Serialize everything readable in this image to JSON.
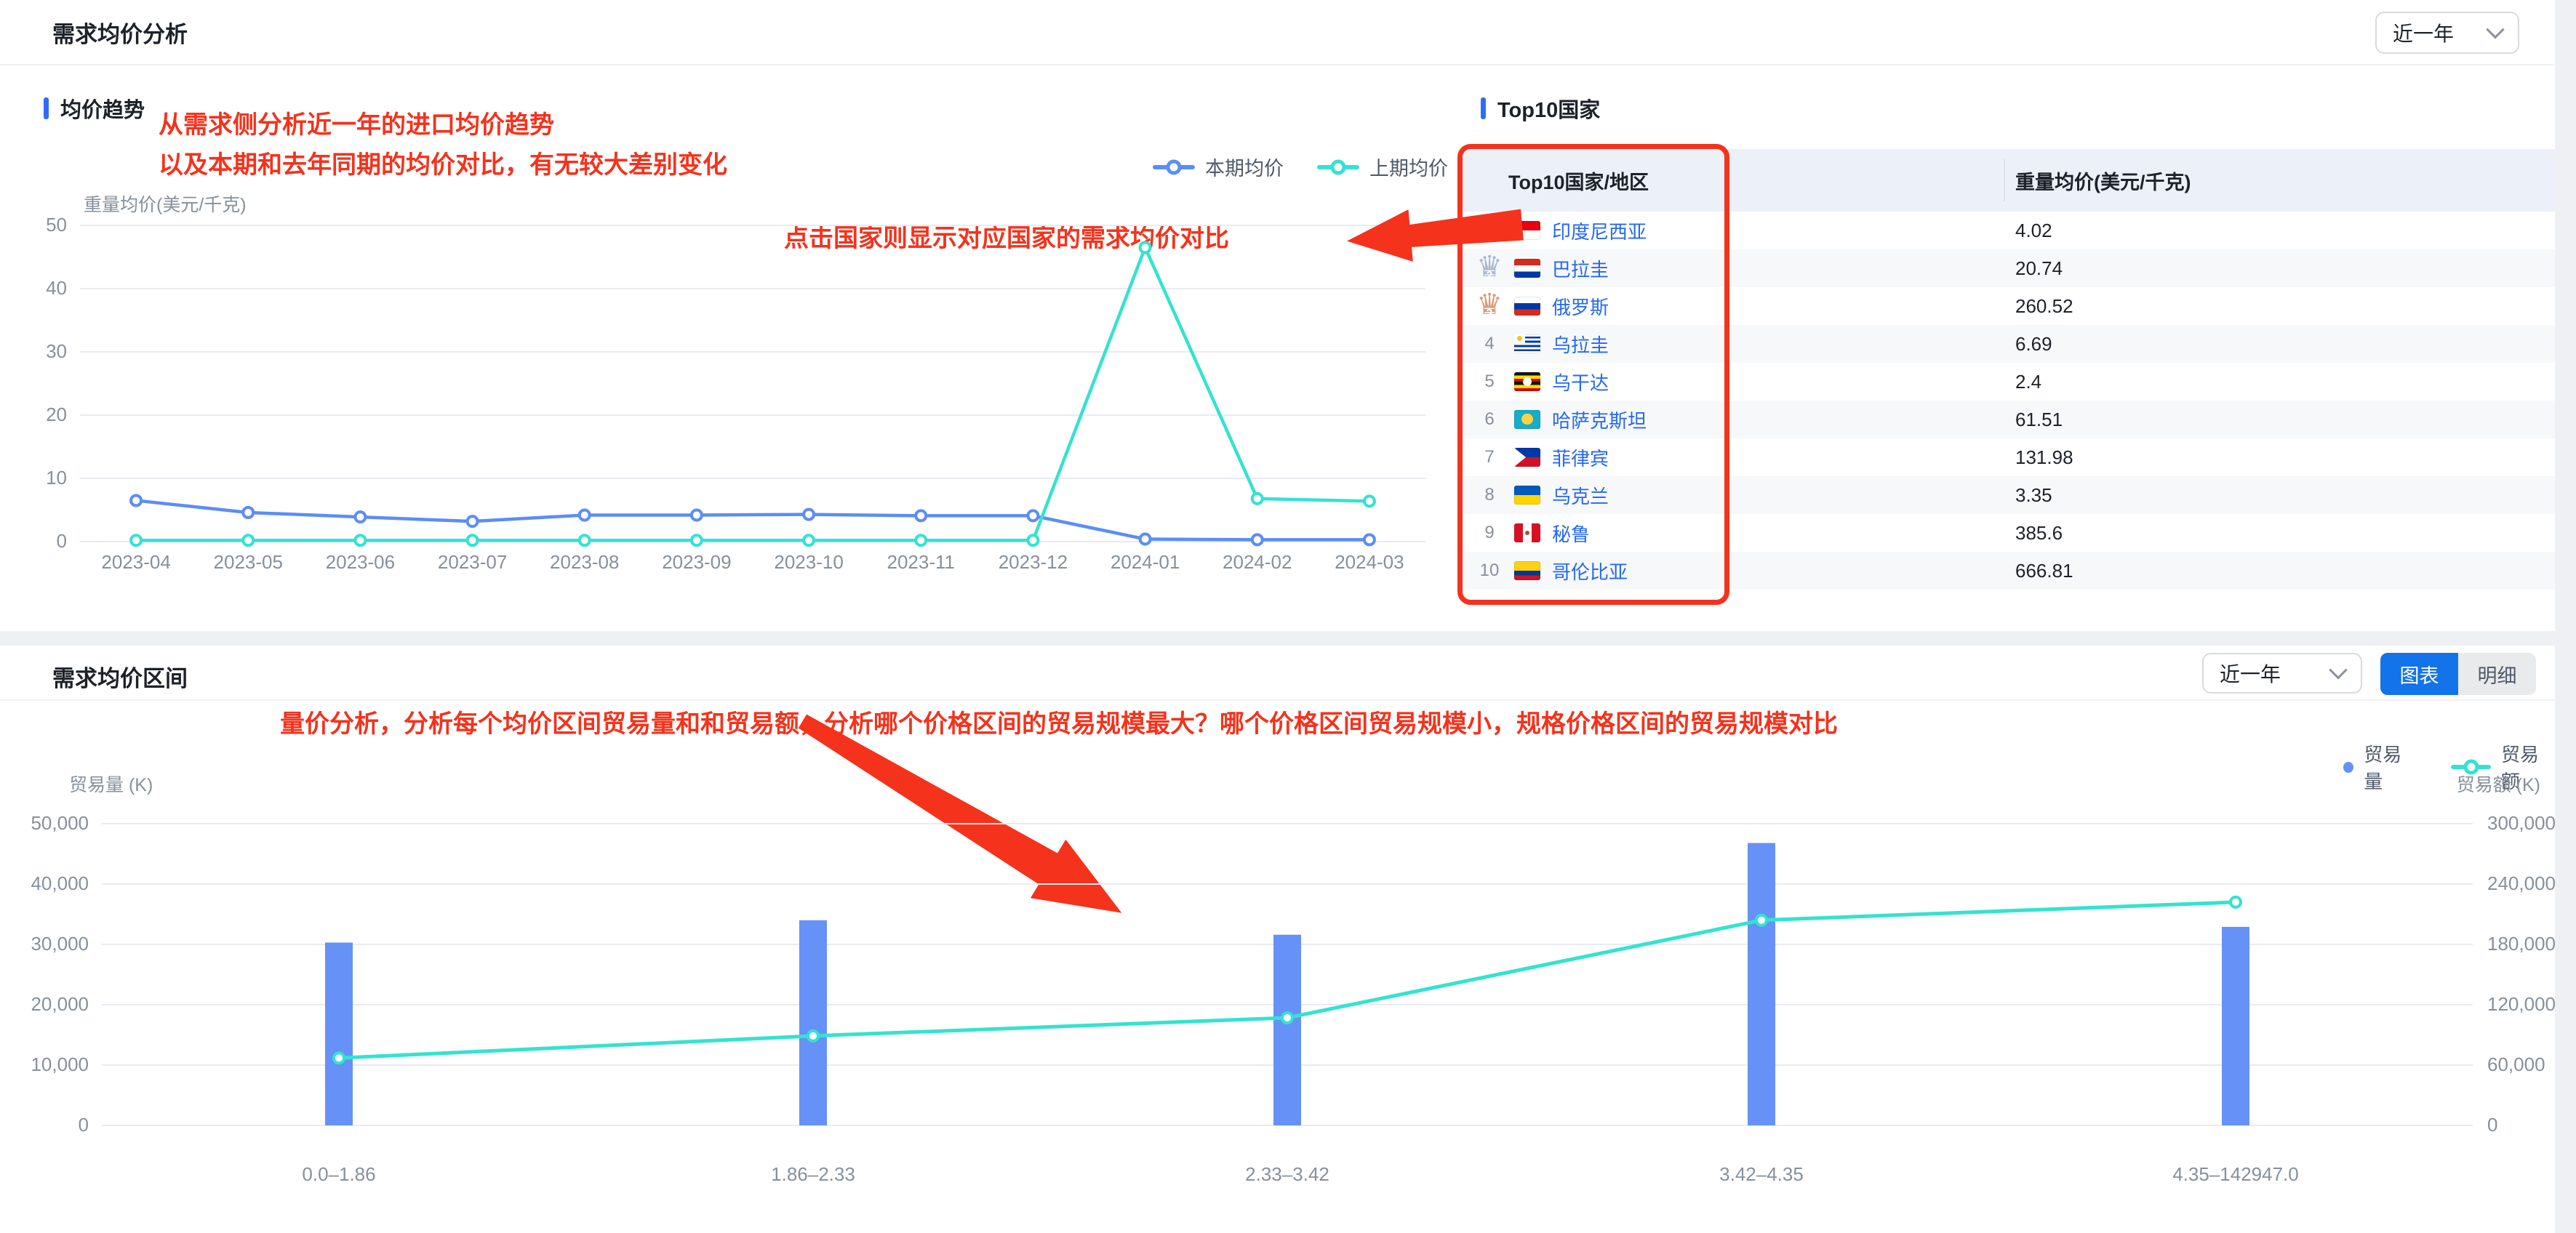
{
  "colors": {
    "accent_blue": "#1273eb",
    "link_blue": "#2468f2",
    "series_blue": "#5c8df6",
    "series_cyan": "#34e3cf",
    "bar_blue": "#6691f7",
    "annotation_red": "#f5321c",
    "axis_gray": "#86909c",
    "table_header_bg": "#ecf0f9"
  },
  "top_card": {
    "title": "需求均价分析",
    "period_select": {
      "value": "近一年"
    },
    "trend": {
      "section_title": "均价趋势",
      "note_line1": "从需求侧分析近一年的进口均价趋势",
      "note_line2": "以及本期和去年同期的均价对比，有无较大差别变化",
      "note_click": "点击国家则显示对应国家的需求均价对比"
    },
    "top10": {
      "section_title": "Top10国家",
      "col_country": "Top10国家/地区",
      "col_value": "重量均价(美元/千克)",
      "rank_medal_colors": [
        "#f2a64a",
        "#aab7cf",
        "#dc9a74"
      ],
      "rows": [
        {
          "rank": 1,
          "country": "印度尼西亚",
          "value": "4.02",
          "flag": {
            "dir": "h",
            "stripes": [
              [
                "#e70011",
                50
              ],
              [
                "#ffffff",
                50
              ]
            ]
          }
        },
        {
          "rank": 2,
          "country": "巴拉圭",
          "value": "20.74",
          "flag": {
            "dir": "h",
            "stripes": [
              [
                "#d52b1e",
                34
              ],
              [
                "#ffffff",
                33
              ],
              [
                "#0038a8",
                33
              ]
            ]
          }
        },
        {
          "rank": 3,
          "country": "俄罗斯",
          "value": "260.52",
          "flag": {
            "dir": "h",
            "stripes": [
              [
                "#ffffff",
                34
              ],
              [
                "#0039a6",
                33
              ],
              [
                "#d52b1e",
                33
              ]
            ]
          }
        },
        {
          "rank": 4,
          "country": "乌拉圭",
          "value": "6.69",
          "flag": {
            "dir": "h",
            "stripes": [
              [
                "#ffffff",
                11
              ],
              [
                "#0038a8",
                11
              ],
              [
                "#ffffff",
                11
              ],
              [
                "#0038a8",
                11
              ],
              [
                "#ffffff",
                12
              ],
              [
                "#0038a8",
                11
              ],
              [
                "#ffffff",
                11
              ],
              [
                "#0038a8",
                11
              ],
              [
                "#ffffff",
                11
              ]
            ],
            "canton": {
              "color": "#ffffff",
              "w": 42,
              "h": 45
            },
            "emblem": {
              "color": "#f5c518",
              "cx": 21,
              "cy": 22,
              "r": 20
            }
          }
        },
        {
          "rank": 5,
          "country": "乌干达",
          "value": "2.4",
          "flag": {
            "dir": "h",
            "stripes": [
              [
                "#141414",
                17
              ],
              [
                "#fcdc04",
                17
              ],
              [
                "#d90000",
                16
              ],
              [
                "#141414",
                17
              ],
              [
                "#fcdc04",
                17
              ],
              [
                "#d90000",
                16
              ]
            ],
            "emblem": {
              "color": "#ffffff",
              "cx": 50,
              "cy": 50,
              "r": 34
            }
          }
        },
        {
          "rank": 6,
          "country": "哈萨克斯坦",
          "value": "61.51",
          "flag": {
            "dir": "h",
            "stripes": [
              [
                "#15adc8",
                100
              ]
            ],
            "emblem": {
              "color": "#ffd23f",
              "cx": 50,
              "cy": 48,
              "r": 42
            }
          }
        },
        {
          "rank": 7,
          "country": "菲律宾",
          "value": "131.98",
          "flag": {
            "dir": "h",
            "stripes": [
              [
                "#0038a8",
                50
              ],
              [
                "#ce1126",
                50
              ]
            ],
            "triangle": "#ffffff"
          }
        },
        {
          "rank": 8,
          "country": "乌克兰",
          "value": "3.35",
          "flag": {
            "dir": "h",
            "stripes": [
              [
                "#005bbb",
                50
              ],
              [
                "#ffd500",
                50
              ]
            ]
          }
        },
        {
          "rank": 9,
          "country": "秘鲁",
          "value": "385.6",
          "flag": {
            "dir": "v",
            "stripes": [
              [
                "#d91023",
                34
              ],
              [
                "#ffffff",
                33
              ],
              [
                "#d91023",
                33
              ]
            ],
            "emblem": {
              "color": "#b5493a",
              "cx": 50,
              "cy": 50,
              "r": 18
            }
          }
        },
        {
          "rank": 10,
          "country": "哥伦比亚",
          "value": "666.81",
          "flag": {
            "dir": "h",
            "stripes": [
              [
                "#fcd116",
                50
              ],
              [
                "#003893",
                25
              ],
              [
                "#ce1126",
                25
              ]
            ]
          }
        }
      ]
    }
  },
  "bottom_card": {
    "title": "需求均价区间",
    "period_select": {
      "value": "近一年"
    },
    "view_toggle": {
      "chart_label": "图表",
      "detail_label": "明细",
      "active": "chart"
    },
    "note": "量价分析，分析每个均价区间贸易量和和贸易额，分析哪个价格区间的贸易规模最大？哪个价格区间贸易规模小，规格价格区间的贸易规模对比"
  },
  "chart_data": [
    {
      "type": "line",
      "title": "均价趋势",
      "y_name": "重量均价(美元/千克)",
      "categories": [
        "2023-04",
        "2023-05",
        "2023-06",
        "2023-07",
        "2023-08",
        "2023-09",
        "2023-10",
        "2023-11",
        "2023-12",
        "2024-01",
        "2024-02",
        "2024-03"
      ],
      "series": [
        {
          "name": "本期均价",
          "color": "#5c8df6",
          "values": [
            6.5,
            4.6,
            3.9,
            3.2,
            4.2,
            4.2,
            4.3,
            4.1,
            4.1,
            0.4,
            0.3,
            0.3
          ]
        },
        {
          "name": "上期均价",
          "color": "#34e3cf",
          "values": [
            0.2,
            0.2,
            0.2,
            0.2,
            0.2,
            0.2,
            0.2,
            0.2,
            0.2,
            46.5,
            6.8,
            6.4
          ]
        }
      ],
      "ylim": [
        0,
        50
      ],
      "y_step": 10,
      "grid": true,
      "legend_position": "top-right"
    },
    {
      "type": "bar+line",
      "title": "需求均价区间",
      "categories": [
        "0.0–1.86",
        "1.86–2.33",
        "2.33–3.42",
        "3.42–4.35",
        "4.35–142947.0"
      ],
      "series": [
        {
          "name": "贸易量",
          "chart": "bar",
          "axis": "left",
          "color": "#6691f7",
          "values": [
            30300,
            34000,
            31600,
            46800,
            32900
          ]
        },
        {
          "name": "贸易额",
          "chart": "line",
          "axis": "right",
          "color": "#34e3cf",
          "values": [
            67000,
            89000,
            107000,
            204000,
            222000
          ]
        }
      ],
      "left_axis": {
        "name": "贸易量 (K)",
        "lim": [
          0,
          50000
        ],
        "step": 10000
      },
      "right_axis": {
        "name": "贸易额 (K)",
        "lim": [
          0,
          300000
        ],
        "step": 60000
      },
      "grid": true,
      "legend_position": "top-right"
    }
  ]
}
